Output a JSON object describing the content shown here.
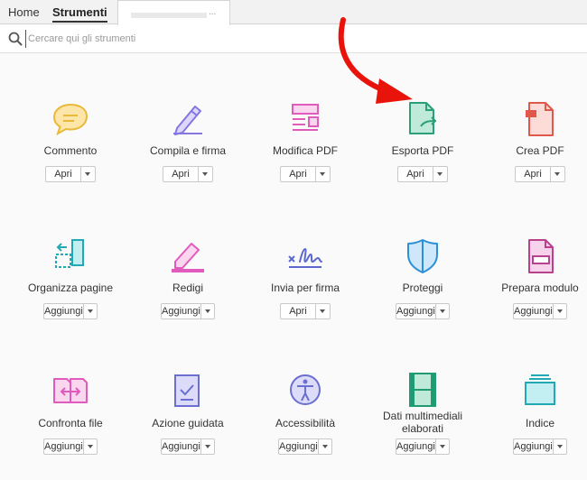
{
  "tabs": {
    "home": "Home",
    "tools": "Strumenti",
    "document_dots": "..."
  },
  "search": {
    "placeholder": "Cercare qui gli strumenti"
  },
  "tools": [
    {
      "label": "Commento",
      "button": "Apri",
      "icon": "comment-icon",
      "color": "#f2c94c"
    },
    {
      "label": "Compila e firma",
      "button": "Apri",
      "icon": "pen-sign-icon",
      "color": "#9b8fe6"
    },
    {
      "label": "Modifica PDF",
      "button": "Apri",
      "icon": "edit-pdf-icon",
      "color": "#e879c9"
    },
    {
      "label": "Esporta PDF",
      "button": "Apri",
      "icon": "export-pdf-icon",
      "color": "#34b38a"
    },
    {
      "label": "Crea PDF",
      "button": "Apri",
      "icon": "create-pdf-icon",
      "color": "#ea6a5f"
    },
    {
      "label": "Organizza pagine",
      "button": "Aggiungi",
      "icon": "organize-pages-icon",
      "color": "#36c0c9"
    },
    {
      "label": "Redigi",
      "button": "Aggiungi",
      "icon": "redact-icon",
      "color": "#e879c9"
    },
    {
      "label": "Invia per firma",
      "button": "Apri",
      "icon": "send-signature-icon",
      "color": "#6f7ad8"
    },
    {
      "label": "Proteggi",
      "button": "Aggiungi",
      "icon": "shield-icon",
      "color": "#3b9ee0"
    },
    {
      "label": "Prepara modulo",
      "button": "Aggiungi",
      "icon": "prepare-form-icon",
      "color": "#c0509a"
    },
    {
      "label": "Confronta file",
      "button": "Aggiungi",
      "icon": "compare-files-icon",
      "color": "#e879c9"
    },
    {
      "label": "Azione guidata",
      "button": "Aggiungi",
      "icon": "guided-action-icon",
      "color": "#7b7fd6"
    },
    {
      "label": "Accessibilità",
      "button": "Aggiungi",
      "icon": "accessibility-icon",
      "color": "#7b7fd6"
    },
    {
      "label": "Dati multimediali elaborati",
      "button": "Aggiungi",
      "icon": "rich-media-icon",
      "color": "#34b38a"
    },
    {
      "label": "Indice",
      "button": "Aggiungi",
      "icon": "index-icon",
      "color": "#36c0c9"
    }
  ]
}
